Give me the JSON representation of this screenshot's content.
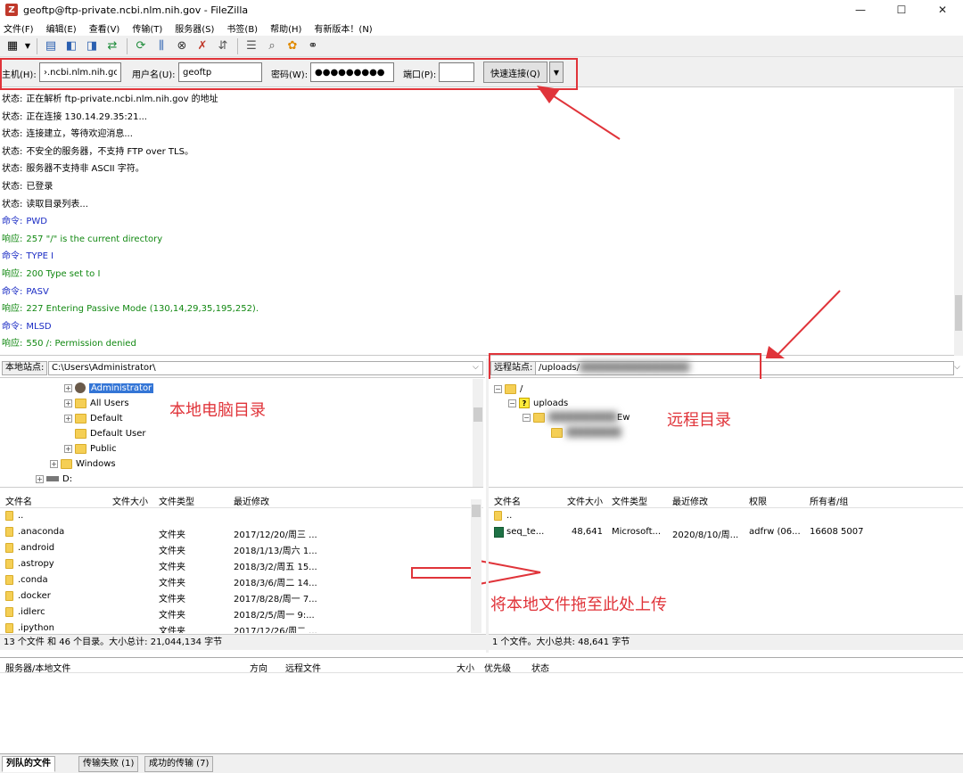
{
  "window": {
    "title": "geoftp@ftp-private.ncbi.nlm.nih.gov - FileZilla",
    "app_icon": "Z"
  },
  "menu": [
    "文件(F)",
    "编辑(E)",
    "查看(V)",
    "传输(T)",
    "服务器(S)",
    "书签(B)",
    "帮助(H)",
    "有新版本！(N)"
  ],
  "quickconnect": {
    "host_label": "主机(H):",
    "host_value": "›.ncbi.nlm.nih.gov",
    "user_label": "用户名(U):",
    "user_value": "geoftp",
    "pass_label": "密码(W):",
    "pass_value": "●●●●●●●●●",
    "port_label": "端口(P):",
    "port_value": "",
    "connect_label": "快速连接(Q)"
  },
  "log": [
    {
      "k": "状态:",
      "t": "正在解析 ftp-private.ncbi.nlm.nih.gov 的地址",
      "c": "st"
    },
    {
      "k": "状态:",
      "t": "正在连接 130.14.29.35:21...",
      "c": "st"
    },
    {
      "k": "状态:",
      "t": "连接建立，等待欢迎消息...",
      "c": "st"
    },
    {
      "k": "状态:",
      "t": "不安全的服务器，不支持 FTP over TLS。",
      "c": "st"
    },
    {
      "k": "状态:",
      "t": "服务器不支持非 ASCII 字符。",
      "c": "st"
    },
    {
      "k": "状态:",
      "t": "已登录",
      "c": "st"
    },
    {
      "k": "状态:",
      "t": "读取目录列表...",
      "c": "st"
    },
    {
      "k": "命令:",
      "t": "PWD",
      "c": "cmd"
    },
    {
      "k": "响应:",
      "t": "257 \"/\" is the current directory",
      "c": "rsp"
    },
    {
      "k": "命令:",
      "t": "TYPE I",
      "c": "cmd"
    },
    {
      "k": "响应:",
      "t": "200 Type set to I",
      "c": "rsp"
    },
    {
      "k": "命令:",
      "t": "PASV",
      "c": "cmd"
    },
    {
      "k": "响应:",
      "t": "227 Entering Passive Mode (130,14,29,35,195,252).",
      "c": "rsp"
    },
    {
      "k": "命令:",
      "t": "MLSD",
      "c": "cmd"
    },
    {
      "k": "响应:",
      "t": "550 /: Permission denied",
      "c": "rsp"
    }
  ],
  "local": {
    "label": "本地站点:",
    "path": "C:\\Users\\Administrator\\",
    "tree": [
      "Administrator",
      "All Users",
      "Default",
      "Default User",
      "Public",
      "Windows",
      "D:"
    ],
    "annotation": "本地电脑目录",
    "headers": [
      "文件名",
      "文件大小",
      "文件类型",
      "最近修改"
    ],
    "files": [
      {
        "name": "..",
        "type": "",
        "date": ""
      },
      {
        "name": ".anaconda",
        "type": "文件夹",
        "date": "2017/12/20/周三 ..."
      },
      {
        "name": ".android",
        "type": "文件夹",
        "date": "2018/1/13/周六 1..."
      },
      {
        "name": ".astropy",
        "type": "文件夹",
        "date": "2018/3/2/周五 15..."
      },
      {
        "name": ".conda",
        "type": "文件夹",
        "date": "2018/3/6/周二 14..."
      },
      {
        "name": ".docker",
        "type": "文件夹",
        "date": "2017/8/28/周一 7..."
      },
      {
        "name": ".idlerc",
        "type": "文件夹",
        "date": "2018/2/5/周一 9:..."
      },
      {
        "name": ".ipython",
        "type": "文件夹",
        "date": "2017/12/26/周二 ..."
      }
    ],
    "status": "13 个文件 和 46 个目录。大小总计: 21,044,134 字节"
  },
  "remote": {
    "label": "远程站点:",
    "path": "/uploads/",
    "tree_root": "/",
    "tree_uploads": "uploads",
    "tree_partial": "Ew",
    "annotation": "远程目录",
    "headers": [
      "文件名",
      "文件大小",
      "文件类型",
      "最近修改",
      "权限",
      "所有者/组"
    ],
    "files": [
      {
        "name": "..",
        "size": "",
        "type": "",
        "date": "",
        "perm": "",
        "owner": ""
      },
      {
        "name": "seq_te...",
        "size": "48,641",
        "type": "Microsoft...",
        "date": "2020/8/10/周...",
        "perm": "adfrw (06...",
        "owner": "16608 5007"
      }
    ],
    "upload_annotation": "将本地文件拖至此处上传",
    "status": "1 个文件。大小总共: 48,641 字节"
  },
  "queue": {
    "headers": [
      "服务器/本地文件",
      "方向",
      "远程文件",
      "大小",
      "优先级",
      "状态"
    ]
  },
  "tabs": [
    "列队的文件",
    "传输失败 (1)",
    "成功的传输 (7)"
  ],
  "colors": {
    "annotation": "#e0343a",
    "selection": "#3375d6",
    "command": "#1a2bc4",
    "response": "#118811"
  }
}
